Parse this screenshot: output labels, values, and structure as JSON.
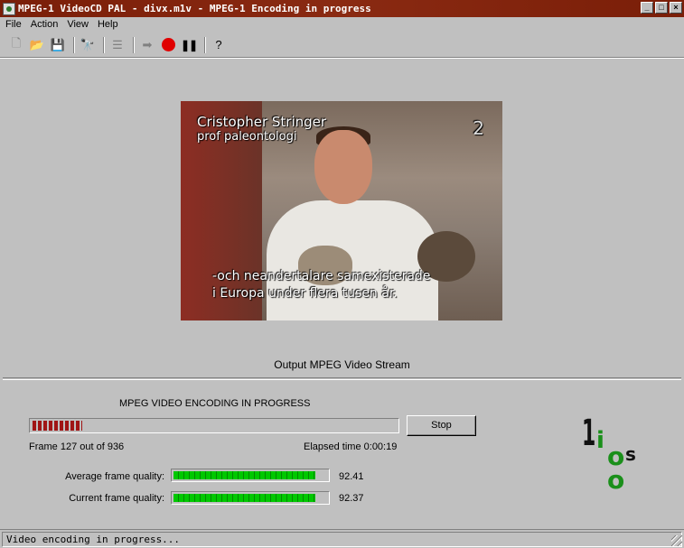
{
  "window": {
    "title": "MPEG-1 VideoCD PAL - divx.m1v - MPEG-1 Encoding in progress",
    "minimize_glyph": "_",
    "maximize_glyph": "□",
    "close_glyph": "×"
  },
  "menu": [
    "File",
    "Action",
    "View",
    "Help"
  ],
  "toolbar": {
    "icons": [
      "new-file-icon",
      "open-folder-icon",
      "save-icon",
      "find-icon",
      "list-icon",
      "arrow-right-icon",
      "record-icon",
      "pause-icon",
      "help-icon"
    ],
    "glyphs": {
      "new": "🗋",
      "open": "📂",
      "save": "💾",
      "find": "🔭",
      "list": "☰",
      "arrow": "➡",
      "pause": "❚❚",
      "help": "?"
    }
  },
  "video": {
    "overlay_name": "Cristopher Stringer",
    "overlay_title": "prof paleontologi",
    "overlay_channel": "2",
    "subtitle_line1": "-och neandertalare samexisterade",
    "subtitle_line2": "i Europa under flera tusen år."
  },
  "stream_label": "Output MPEG Video Stream",
  "encoding": {
    "heading": "MPEG VIDEO ENCODING IN PROGRESS",
    "progress_fraction": 0.136,
    "stop_label": "Stop",
    "frame_text": "Frame 127 out of 936",
    "elapsed_text": "Elapsed time  0:00:19",
    "avg_quality_label": "Average frame quality:",
    "avg_quality_value": "92.41",
    "avg_quality_fraction": 0.9241,
    "cur_quality_label": "Current frame quality:",
    "cur_quality_value": "92.37",
    "cur_quality_fraction": 0.9237
  },
  "logo": {
    "parts": [
      "1",
      "i",
      "o",
      "s",
      "o"
    ]
  },
  "status": {
    "text": "Video encoding in progress..."
  },
  "colors": {
    "titlebar": "#7a1e08",
    "progress": "#a01515",
    "quality": "#00c800",
    "logo_green": "#1a8f1a"
  }
}
